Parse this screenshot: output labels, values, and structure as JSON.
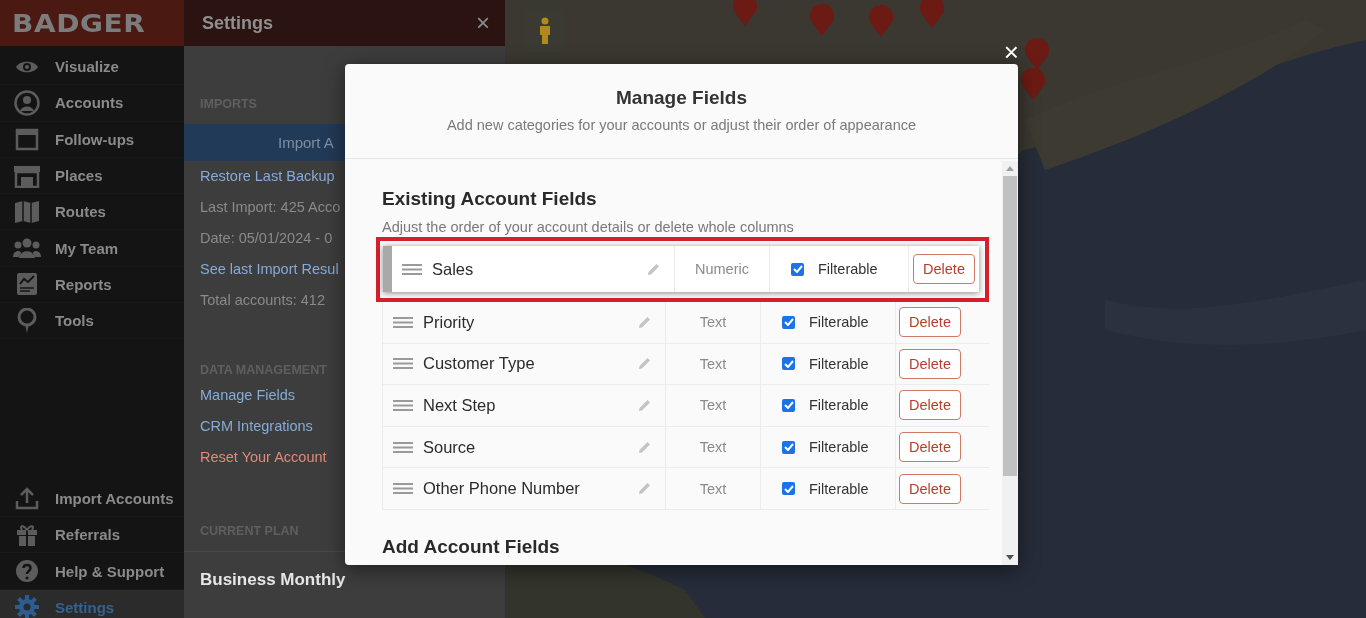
{
  "sidebar": {
    "logo": "BADGER",
    "items": [
      {
        "label": "Visualize",
        "selected": false
      },
      {
        "label": "Accounts",
        "selected": false
      },
      {
        "label": "Follow-ups",
        "selected": false
      },
      {
        "label": "Places",
        "selected": false
      },
      {
        "label": "Routes",
        "selected": false
      },
      {
        "label": "My Team",
        "selected": false
      },
      {
        "label": "Reports",
        "selected": false
      },
      {
        "label": "Tools",
        "selected": false
      }
    ],
    "bottom_items": [
      {
        "label": "Import Accounts",
        "selected": false
      },
      {
        "label": "Referrals",
        "selected": false
      },
      {
        "label": "Help & Support",
        "selected": false
      },
      {
        "label": "Settings",
        "selected": true
      }
    ]
  },
  "settings_panel": {
    "title": "Settings",
    "close": "×",
    "sections": [
      {
        "heading": "IMPORTS",
        "items": [
          {
            "kind": "button",
            "text": "Import A"
          },
          {
            "kind": "link",
            "text": "Restore Last Backup"
          },
          {
            "kind": "info",
            "text": "Last Import: 425 Acco"
          },
          {
            "kind": "info",
            "text": "Date: 05/01/2024 - 0"
          },
          {
            "kind": "link",
            "text": "See last Import Resul"
          },
          {
            "kind": "info",
            "text": "Total accounts: 412"
          }
        ]
      },
      {
        "heading": "DATA MANAGEMENT",
        "items": [
          {
            "kind": "link",
            "text": "Manage Fields"
          },
          {
            "kind": "link",
            "text": "CRM Integrations"
          },
          {
            "kind": "danger",
            "text": "Reset Your Account"
          }
        ]
      },
      {
        "heading": "CURRENT PLAN",
        "items": [
          {
            "kind": "plan",
            "text": "Business Monthly"
          }
        ]
      }
    ]
  },
  "modal": {
    "close": "×",
    "title": "Manage Fields",
    "subtitle": "Add new categories for your accounts or adjust their order of appearance",
    "existing": {
      "heading": "Existing Account Fields",
      "description": "Adjust the order of your account details or delete whole columns",
      "rows": [
        {
          "name": "Sales",
          "type": "Numeric",
          "filterable": true,
          "filter_label": "Filterable",
          "delete_label": "Delete",
          "dragging": true
        },
        {
          "name": "Priority",
          "type": "Text",
          "filterable": true,
          "filter_label": "Filterable",
          "delete_label": "Delete",
          "dragging": false
        },
        {
          "name": "Customer Type",
          "type": "Text",
          "filterable": true,
          "filter_label": "Filterable",
          "delete_label": "Delete",
          "dragging": false
        },
        {
          "name": "Next Step",
          "type": "Text",
          "filterable": true,
          "filter_label": "Filterable",
          "delete_label": "Delete",
          "dragging": false
        },
        {
          "name": "Source",
          "type": "Text",
          "filterable": true,
          "filter_label": "Filterable",
          "delete_label": "Delete",
          "dragging": false
        },
        {
          "name": "Other Phone Number",
          "type": "Text",
          "filterable": true,
          "filter_label": "Filterable",
          "delete_label": "Delete",
          "dragging": false
        }
      ]
    },
    "add": {
      "heading": "Add Account Fields"
    }
  }
}
